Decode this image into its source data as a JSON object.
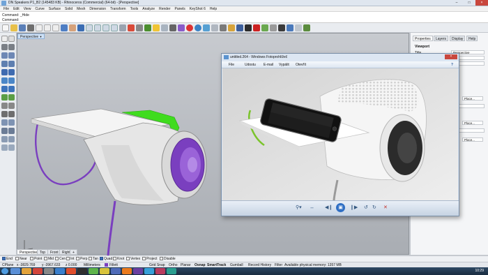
{
  "window": {
    "title": "DN Speakers P1_B2 (145483 KB) - Rhinoceros (Commercial) (64-bit) - [Perspective]"
  },
  "menu": [
    "File",
    "Edit",
    "View",
    "Curve",
    "Surface",
    "Solid",
    "Mesh",
    "Dimension",
    "Transform",
    "Tools",
    "Analyze",
    "Render",
    "Panels",
    "KeyShot 6",
    "Help"
  ],
  "command": {
    "history": "Command: _Hide",
    "prompt": "Command:"
  },
  "viewport": {
    "active_label": "Perspective",
    "tabs": [
      "Perspective",
      "Top",
      "Front",
      "Right"
    ],
    "add_tab": "+"
  },
  "right_panel": {
    "tabs": [
      "Properties",
      "Layers",
      "Display",
      "Help"
    ],
    "section": "Viewport",
    "rows": [
      {
        "label": "Title",
        "value": "Perspective"
      }
    ],
    "place_buttons": [
      "Place...",
      "Place...",
      "Place..."
    ]
  },
  "viewer": {
    "title": "untitled.264 - Windows Fotoprohlížeč",
    "menu": [
      "File",
      "Udostu",
      "E-mail",
      "Vypálit",
      "Otevřít"
    ],
    "help": "?",
    "controls": [
      "zoom",
      "actual-size",
      "previous",
      "slideshow",
      "next",
      "rotate-left",
      "rotate-right",
      "delete"
    ]
  },
  "osnap": [
    {
      "label": "End",
      "on": true
    },
    {
      "label": "Near",
      "on": false
    },
    {
      "label": "Point",
      "on": false
    },
    {
      "label": "Mid",
      "on": false
    },
    {
      "label": "Cen",
      "on": false
    },
    {
      "label": "Int",
      "on": false
    },
    {
      "label": "Perp",
      "on": false
    },
    {
      "label": "Tan",
      "on": false
    },
    {
      "label": "Quad",
      "on": true
    },
    {
      "label": "Knot",
      "on": false
    },
    {
      "label": "Vertex",
      "on": false
    },
    {
      "label": "Project",
      "on": false
    },
    {
      "label": "Disable",
      "on": false
    }
  ],
  "status": {
    "cplane": "CPlane",
    "x": "x -3829.769",
    "y": "y -3967.633",
    "z": "z 0.000",
    "units": "Millimeters",
    "layer": "Fillett",
    "grid_snap": "Grid Snap",
    "ortho": "Ortho",
    "planar": "Planar",
    "osnap": "Osnap",
    "smarttrack": "SmartTrack",
    "gumball": "Gumball",
    "record_history": "Record History",
    "filter": "Filter",
    "memory": "Available physical memory: 1357 MB"
  },
  "taskbar": {
    "clock": "10:29"
  },
  "colors": {
    "speaker_purple": "#7a3fbf",
    "speaker_green": "#3fdc1e",
    "shell_white": "#f2f2f2"
  }
}
